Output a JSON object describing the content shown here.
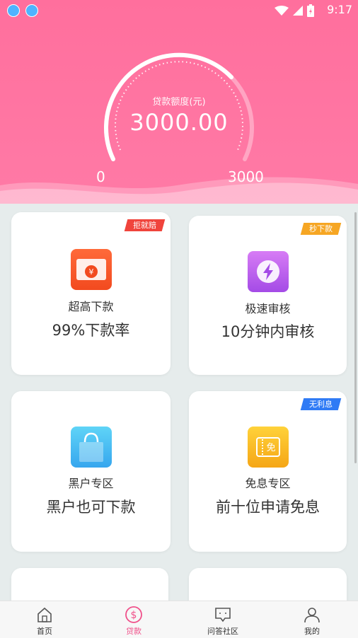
{
  "status_bar": {
    "time": "9:17"
  },
  "header": {
    "gauge_label": "贷款额度(元)",
    "amount": "3000.00",
    "min_label": "0",
    "max_label": "3000",
    "colors": {
      "primary": "#ff6f9d"
    }
  },
  "cards": [
    {
      "badge": "拒就赔",
      "badge_color": "#f0443c",
      "icon": "money-envelope-icon",
      "title": "超高下款",
      "subtitle": "99%下款率"
    },
    {
      "badge": "秒下款",
      "badge_color": "#f6a623",
      "icon": "lightning-icon",
      "title": "极速审核",
      "subtitle": "10分钟内审核"
    },
    {
      "badge": "",
      "icon": "shopping-bag-icon",
      "title": "黑户专区",
      "subtitle": "黑户也可下款"
    },
    {
      "badge": "无利息",
      "badge_color": "#2f7bf5",
      "icon": "coupon-icon",
      "title": "免息专区",
      "subtitle": "前十位申请免息",
      "icon_char": "免"
    }
  ],
  "tabbar": {
    "tabs": [
      {
        "label": "首页",
        "icon": "home-icon",
        "active": false
      },
      {
        "label": "贷款",
        "icon": "dollar-icon",
        "active": true
      },
      {
        "label": "问答社区",
        "icon": "chat-icon",
        "active": false
      },
      {
        "label": "我的",
        "icon": "user-icon",
        "active": false
      }
    ],
    "active_color": "#f0508a"
  }
}
